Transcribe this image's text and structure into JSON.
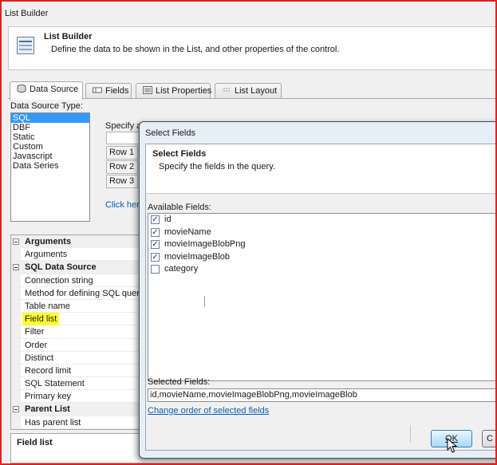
{
  "window": {
    "title": "List Builder"
  },
  "header": {
    "title": "List Builder",
    "description": "Define the data to be shown in the List, and other properties of the control."
  },
  "tabs": [
    {
      "label": "Data Source",
      "icon": "database-icon"
    },
    {
      "label": "Fields",
      "icon": "fields-icon"
    },
    {
      "label": "List Properties",
      "icon": "properties-icon"
    },
    {
      "label": "List Layout",
      "icon": "layout-icon"
    }
  ],
  "data_source": {
    "label": "Data Source Type:",
    "types": [
      "SQL",
      "DBF",
      "Static",
      "Custom",
      "Javascript",
      "Data Series"
    ],
    "selected": "SQL"
  },
  "middle": {
    "specify": "Specify a",
    "rows": [
      "Row 1",
      "Row 2",
      "Row 3"
    ],
    "click_here": "Click here"
  },
  "properties": [
    {
      "kind": "cat",
      "label": "Arguments"
    },
    {
      "kind": "item",
      "label": "Arguments"
    },
    {
      "kind": "cat",
      "label": "SQL Data Source"
    },
    {
      "kind": "item",
      "label": "Connection string"
    },
    {
      "kind": "item",
      "label": "Method for defining SQL query"
    },
    {
      "kind": "item",
      "label": "Table name"
    },
    {
      "kind": "item",
      "label": "Field list",
      "highlight": "#ffff33"
    },
    {
      "kind": "item",
      "label": "Filter"
    },
    {
      "kind": "item",
      "label": "Order"
    },
    {
      "kind": "item",
      "label": "Distinct"
    },
    {
      "kind": "item",
      "label": "Record limit"
    },
    {
      "kind": "item",
      "label": "SQL Statement"
    },
    {
      "kind": "item",
      "label": "Primary key"
    },
    {
      "kind": "cat",
      "label": "Parent List"
    },
    {
      "kind": "item",
      "label": "Has parent list"
    }
  ],
  "description_panel": {
    "title": "Field list"
  },
  "dialog": {
    "title": "Select Fields",
    "heading": "Select Fields",
    "subheading": "Specify the fields in the query.",
    "available_label": "Available Fields:",
    "fields": [
      {
        "name": "id",
        "checked": true
      },
      {
        "name": "movieName",
        "checked": true
      },
      {
        "name": "movieImageBlobPng",
        "checked": true
      },
      {
        "name": "movieImageBlob",
        "checked": true
      },
      {
        "name": "category",
        "checked": false
      }
    ],
    "selected_label": "Selected Fields:",
    "selected_value": "id,movieName,movieImageBlobPng,movieImageBlob",
    "change_order_link": "Change order of selected fields",
    "ok_label": "OK",
    "cancel_label": "C"
  },
  "colors": {
    "frame_border": "#e32020",
    "selection": "#3399ff",
    "highlight": "#ffff33",
    "link": "#0b5fb0"
  }
}
